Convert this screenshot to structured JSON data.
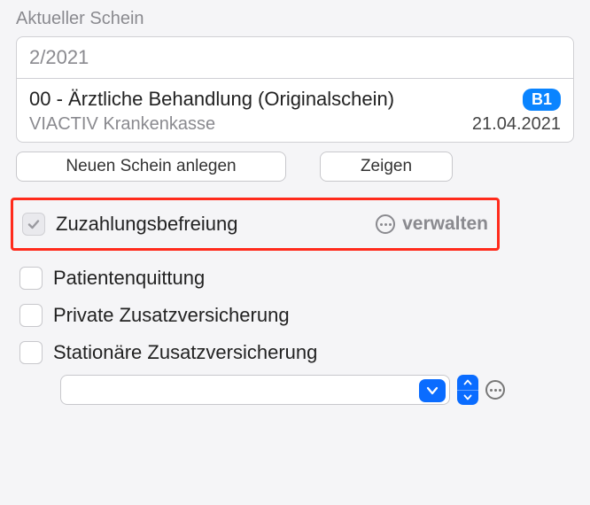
{
  "section_label": "Aktueller Schein",
  "card": {
    "period": "2/2021",
    "treatment": "00 - Ärztliche Behandlung (Originalschein)",
    "badge": "B1",
    "insurer": "VIACTIV Krankenkasse",
    "date": "21.04.2021"
  },
  "buttons": {
    "new_label": "Neuen Schein anlegen",
    "show_label": "Zeigen"
  },
  "options": {
    "zuzahlung": {
      "label": "Zuzahlungsbefreiung",
      "checked": true
    },
    "manage_label": "verwalten",
    "patientenquittung": {
      "label": "Patientenquittung",
      "checked": false
    },
    "private_zusatz": {
      "label": "Private Zusatzversicherung",
      "checked": false
    },
    "stationaere_zusatz": {
      "label": "Stationäre Zusatzversicherung",
      "checked": false
    }
  },
  "combo": {
    "value": ""
  }
}
